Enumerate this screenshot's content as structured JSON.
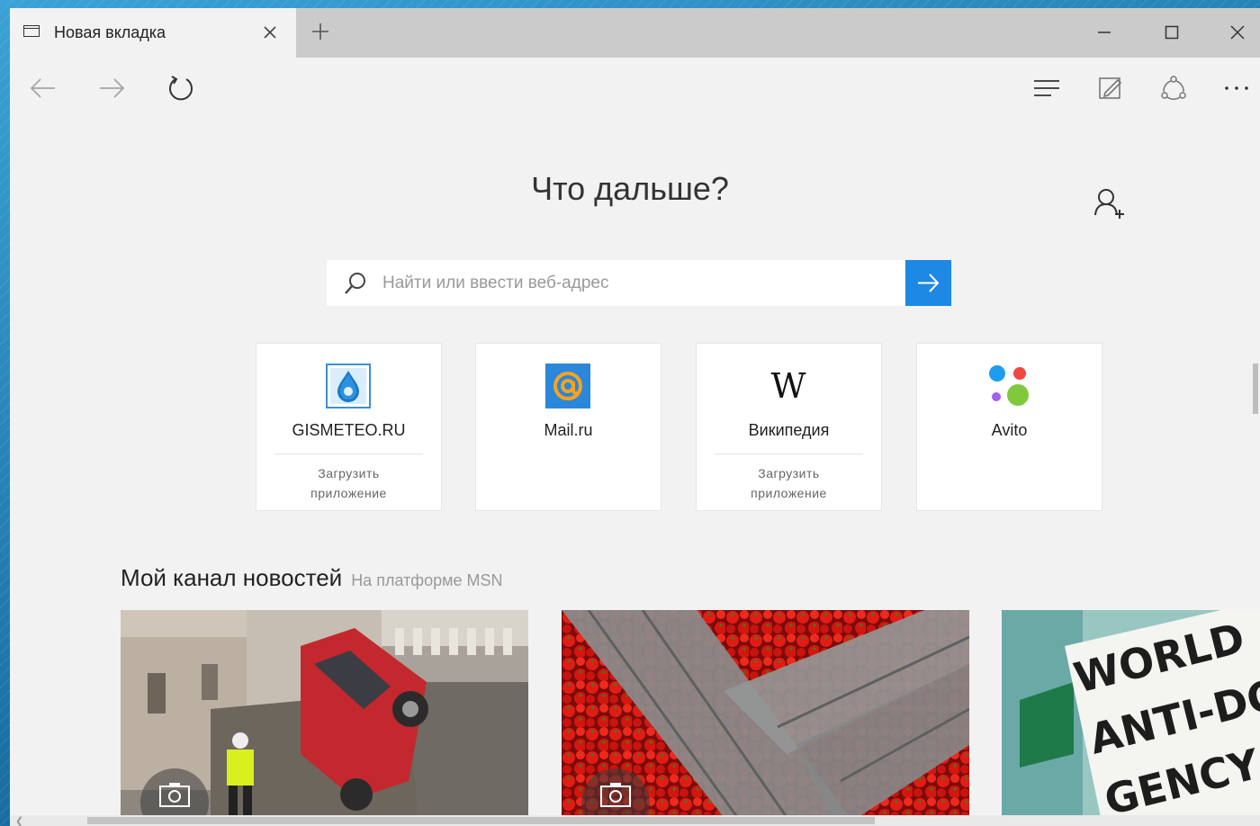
{
  "tab": {
    "title": "Новая вкладка"
  },
  "page": {
    "heading": "Что дальше?"
  },
  "search": {
    "placeholder": "Найти или ввести веб-адрес"
  },
  "tiles": [
    {
      "name": "GISMETEO.RU",
      "sub": "Загрузить приложение",
      "icon": "gismeteo-icon"
    },
    {
      "name": "Mail.ru",
      "sub": "",
      "icon": "mailru-icon"
    },
    {
      "name": "Википедия",
      "sub": "Загрузить приложение",
      "icon": "wikipedia-icon"
    },
    {
      "name": "Avito",
      "sub": "",
      "icon": "avito-icon"
    }
  ],
  "news": {
    "heading": "Мой канал новостей",
    "source": "На платформе MSN",
    "cards": [
      {
        "image": "crashed-red-car-photo",
        "badge": "camera-icon"
      },
      {
        "image": "tomato-crates-photo",
        "badge": "camera-icon"
      },
      {
        "image": "world-anti-doping-agency-sign-photo",
        "sign_text": [
          "WORLD",
          "ANTI-DOPI",
          "GENCY"
        ]
      }
    ]
  },
  "colors": {
    "accent": "#1e88e5",
    "frame": "#1f7fb0",
    "chrome": "#cbcbcb",
    "page_bg": "#f2f2f2"
  }
}
